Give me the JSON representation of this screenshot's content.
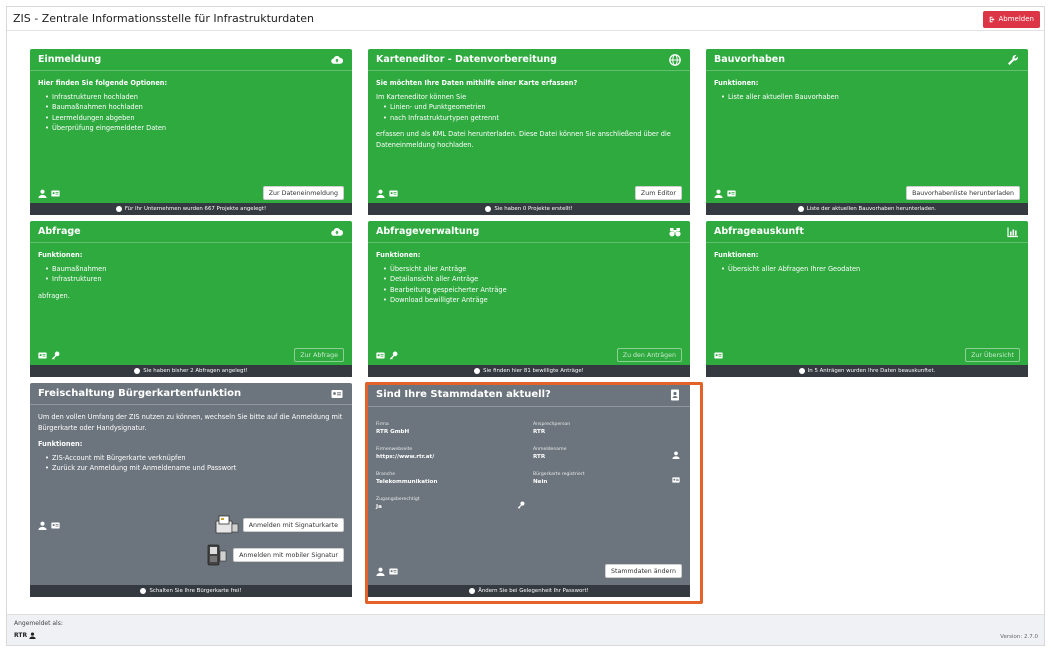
{
  "app": {
    "title": "ZIS - Zentrale Informationsstelle für Infrastrukturdaten",
    "logout_label": "Abmelden",
    "version": "Version: 2.7.0"
  },
  "colors": {
    "green": "#2eaa3f",
    "gray": "#6c757d",
    "dark": "#343a40",
    "danger": "#dc3545",
    "highlight": "#e2622a"
  },
  "cards": {
    "einmeldung": {
      "title": "Einmeldung",
      "icon": "cloud-upload-icon",
      "lead": "Hier finden Sie folgende Optionen:",
      "items": [
        "Infrastrukturen hochladen",
        "Baumaßnahmen hochladen",
        "Leermeldungen abgeben",
        "Überprüfung eingemeldeter Daten"
      ],
      "button": "Zur Dateneinmeldung",
      "status": "Für Ihr Unternehmen wurden 667 Projekte angelegt!"
    },
    "karteneditor": {
      "title": "Karteneditor - Datenvorbereitung",
      "icon": "globe-icon",
      "lead": "Sie möchten Ihre Daten mithilfe einer Karte erfassen?",
      "intro": "Im Karteneditor können Sie",
      "items": [
        "Linien- und Punktgeometrien",
        "nach Infrastrukturtypen getrennt"
      ],
      "outro": "erfassen und als KML Datei herunterladen. Diese Datei können Sie anschließend über die Dateneinmeldung hochladen.",
      "button": "Zum Editor",
      "status": "Sie haben 0 Projekte erstellt!"
    },
    "bauvorhaben": {
      "title": "Bauvorhaben",
      "icon": "wrench-icon",
      "lead": "Funktionen:",
      "items": [
        "Liste aller aktuellen Bauvorhaben"
      ],
      "button": "Bauvorhabenliste herunterladen",
      "status": "Liste der aktuellen Bauvorhaben herunterladen."
    },
    "abfrage": {
      "title": "Abfrage",
      "icon": "cloud-upload-icon",
      "lead": "Funktionen:",
      "items": [
        "Baumaßnahmen",
        "Infrastrukturen"
      ],
      "outro": "abfragen.",
      "button": "Zur Abfrage",
      "status": "Sie haben bisher 2 Abfragen angelegt!"
    },
    "abfrageverwaltung": {
      "title": "Abfrageverwaltung",
      "icon": "binoculars-icon",
      "lead": "Funktionen:",
      "items": [
        "Übersicht aller Anträge",
        "Detailansicht aller Anträge",
        "Bearbeitung gespeicherter Anträge",
        "Download bewilligter Anträge"
      ],
      "button": "Zu den Anträgen",
      "status": "Sie finden hier 81 bewilligte Anträge!"
    },
    "abfrageauskunft": {
      "title": "Abfrageauskunft",
      "icon": "bar-chart-icon",
      "lead": "Funktionen:",
      "items": [
        "Übersicht aller Abfragen Ihrer Geodaten"
      ],
      "button": "Zur Übersicht",
      "status": "In 5 Anträgen wurden Ihre Daten beauskunftet."
    },
    "freischaltung": {
      "title": "Freischaltung Bürgerkartenfunktion",
      "icon": "id-card-icon",
      "intro": "Um den vollen Umfang der ZIS nutzen zu können, wechseln Sie bitte auf die Anmeldung mit Bürgerkarte oder Handysignatur.",
      "lead": "Funktionen:",
      "items": [
        "ZIS-Account mit Bürgerkarte verknüpfen",
        "Zurück zur Anmeldung mit Anmeldename und Passwort"
      ],
      "button_card": "Anmelden mit Signaturkarte",
      "button_mobile": "Anmelden mit mobiler Signatur",
      "status": "Schalten Sie Ihre Bürgerkarte frei!"
    },
    "stammdaten": {
      "title": "Sind Ihre Stammdaten aktuell?",
      "icon": "address-book-icon",
      "fields": {
        "firma_label": "Firma",
        "firma_value": "RTR GmbH",
        "ansprech_label": "Ansprechperson",
        "ansprech_value": "RTR",
        "website_label": "Firmenwebseite",
        "website_value": "https://www.rtr.at/",
        "anmeldename_label": "Anmeldename",
        "anmeldename_value": "RTR",
        "branche_label": "Branche",
        "branche_value": "Telekommunikation",
        "buergerkarte_label": "Bürgerkarte registriert",
        "buergerkarte_value": "Nein",
        "zugang_label": "Zugangsberechtigt",
        "zugang_value": "Ja"
      },
      "button": "Stammdaten ändern",
      "status": "Ändern Sie bei Gelegenheit Ihr Passwort!"
    }
  },
  "footer": {
    "logged_in_label": "Angemeldet als:",
    "user": "RTR"
  }
}
